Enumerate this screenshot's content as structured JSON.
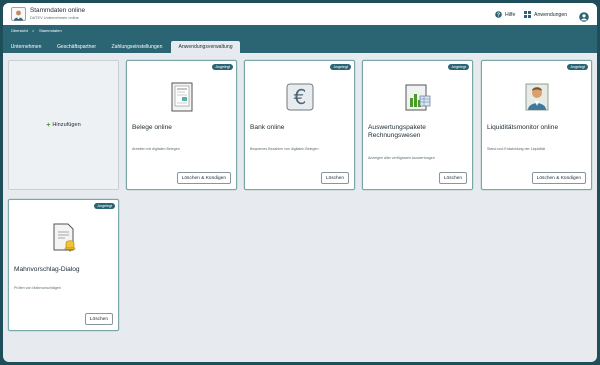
{
  "header": {
    "title": "Stammdaten online",
    "subtitle": "DATEV Unternehmen online",
    "help_label": "Hilfe",
    "apps_label": "Anwendungen"
  },
  "breadcrumb": {
    "items": [
      "Übersicht",
      "Stammdaten"
    ],
    "separator": ">"
  },
  "tabs": [
    {
      "label": "Unternehmen",
      "active": false
    },
    {
      "label": "Geschäftspartner",
      "active": false
    },
    {
      "label": "Zahlungseinstellungen",
      "active": false
    },
    {
      "label": "Anwendungsverwaltung",
      "active": true
    }
  ],
  "add_card": {
    "label": "Hinzufügen"
  },
  "cards": [
    {
      "title": "Belege online",
      "description": "Arbeiten mit digitalen Belegen",
      "badge": "Angelegt",
      "button": "Löschen & Kündigen",
      "icon": "receipt-icon"
    },
    {
      "title": "Bank online",
      "description": "Bequemes Bezahlen von digitalen Belegen",
      "badge": "Angelegt",
      "button": "Löschen",
      "icon": "euro-icon"
    },
    {
      "title": "Auswertungspakete Rechnungswesen",
      "description": "Anzeigen aller verfügbaren Auswertungen",
      "badge": "Angelegt",
      "button": "Löschen",
      "icon": "report-chart-icon"
    },
    {
      "title": "Liquiditätsmonitor online",
      "description": "Stand und Entwicklung der Liquidität",
      "badge": "Angelegt",
      "button": "Löschen & Kündigen",
      "icon": "person-icon"
    },
    {
      "title": "Mahnvorschlag-Dialog",
      "description": "Prüfen von Mahnvorschlägen",
      "badge": "Angelegt",
      "button": "Löschen",
      "icon": "document-bell-icon"
    }
  ],
  "colors": {
    "accent": "#2b6473",
    "card_border": "#7aa7a7",
    "background": "#e7ebef"
  }
}
